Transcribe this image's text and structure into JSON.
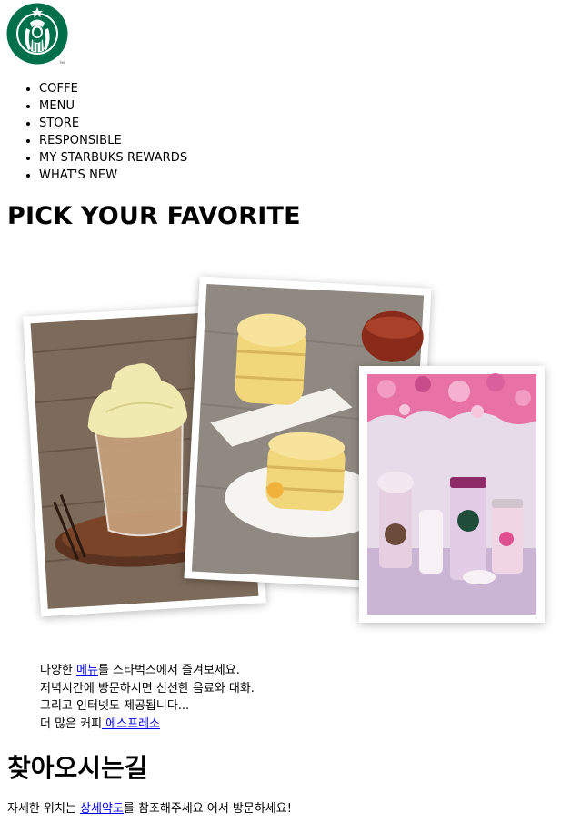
{
  "logo": {
    "icon": "starbucks-siren-logo-icon",
    "brand_color": "#00704a"
  },
  "nav": {
    "items": [
      {
        "label": "COFFE"
      },
      {
        "label": "MENU"
      },
      {
        "label": "STORE"
      },
      {
        "label": "RESPONSIBLE"
      },
      {
        "label": "MY STARBUKS REWARDS"
      },
      {
        "label": "WHAT'S NEW"
      }
    ]
  },
  "main": {
    "title": "PICK YOUR FAVORITE",
    "images": [
      {
        "icon": "frappuccino-photo-icon"
      },
      {
        "icon": "cake-and-tea-photo-icon"
      },
      {
        "icon": "cherry-blossom-tumblers-photo-icon"
      }
    ],
    "desc": {
      "line1_prefix": "다양한 ",
      "line1_link": "메뉴",
      "line1_suffix": "를 스타벅스에서 즐겨보세요.",
      "line2": "저녁시간에 방문하시면 신선한 음료와 대화.",
      "line3": "그리고 인터넷도 제공됩니다...",
      "line4_prefix": "더 많은 커피",
      "line4_link": " 에스프레소"
    }
  },
  "directions": {
    "title": "찾아오시는길",
    "text_prefix": "자세한 위치는 ",
    "link": "상세약도",
    "text_suffix": "를 참조해주세요 어서 방문하세요!"
  }
}
